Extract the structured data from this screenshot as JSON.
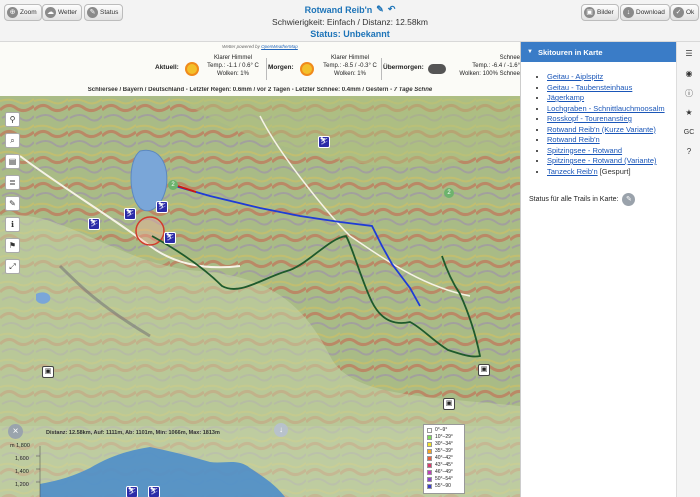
{
  "toolbar": {
    "zoom_label": "Zoom",
    "weather_label": "Wetter",
    "status_label": "Status",
    "images_label": "Bilder",
    "download_label": "Download",
    "ok_label": "Ok"
  },
  "header": {
    "title": "Rotwand Reib'n",
    "subtitle": "Schwierigkeit: Einfach / Distanz: 12.58km",
    "status": "Status: Unbekannt"
  },
  "weather": {
    "powered_by_prefix": "Wetter powered by",
    "powered_by_link": "OpenWeatherMap",
    "current_label": "Aktuell:",
    "current_desc": "Klarer Himmel",
    "current_temp": "Temp.: -1.1 / 0.6° C",
    "current_clouds": "Wolken: 1%",
    "tomorrow_label": "Morgen:",
    "tomorrow_desc": "Klarer Himmel",
    "tomorrow_temp": "Temp.: -8.5 / -0.3° C",
    "tomorrow_clouds": "Wolken: 1%",
    "dayafter_label": "Übermorgen:",
    "dayafter_desc": "Schnee",
    "dayafter_temp": "Temp.: -6.4 / -1.6°",
    "dayafter_clouds": "Wolken: 100%  Schnee",
    "info_line_main": "Schliersee / Bayern / Deutschland - Letzter Regen: 0.6mm / vor 2 Tagen - Letzter Schnee: 0.4mm / Gestern - ",
    "info_line_tail": "7 Tage Schne"
  },
  "map": {
    "elevation_info": "Distanz: 12.58km, Auf: 1111m, Ab: 1101m, Min: 1066m, Max: 1813m",
    "y_ticks": [
      "1,600",
      "1,400",
      "1,200"
    ],
    "y_top_tick": "m 1,800",
    "poi_markers": [
      "2",
      "2"
    ],
    "legend": [
      {
        "label": "0°–9°",
        "color": "#ffffff"
      },
      {
        "label": "10°–29°",
        "color": "#7ed957"
      },
      {
        "label": "30°–34°",
        "color": "#f2e22a"
      },
      {
        "label": "35°–39°",
        "color": "#f5a623"
      },
      {
        "label": "40°–42°",
        "color": "#e85d3a"
      },
      {
        "label": "43°–45°",
        "color": "#d93a6a"
      },
      {
        "label": "46°–49°",
        "color": "#c03fb8"
      },
      {
        "label": "50°–54°",
        "color": "#8c3fcf"
      },
      {
        "label": "55°–90",
        "color": "#3b3fc8"
      }
    ]
  },
  "panel": {
    "title": "Skitouren in Karte",
    "trails": [
      {
        "name": "Geitau - Aiplspitz",
        "note": ""
      },
      {
        "name": "Geitau - Taubensteinhaus",
        "note": ""
      },
      {
        "name": "Jägerkamp",
        "note": ""
      },
      {
        "name": "Lochgraben - Schnittlauchmoosalm",
        "note": ""
      },
      {
        "name": "Rosskopf - Tourenanstieg",
        "note": ""
      },
      {
        "name": "Rotwand Reib'n (Kurze Variante)",
        "note": ""
      },
      {
        "name": "Rotwand Reib'n",
        "note": ""
      },
      {
        "name": "Spitzingsee - Rotwand",
        "note": ""
      },
      {
        "name": "Spitzingsee - Rotwand (Variante)",
        "note": ""
      },
      {
        "name": "Tanzeck Reib'n",
        "note": "[Gespurt]"
      }
    ],
    "status_all_label": "Status für alle Trails in Karte:"
  },
  "sidebar": {
    "gc_label": "GC"
  }
}
